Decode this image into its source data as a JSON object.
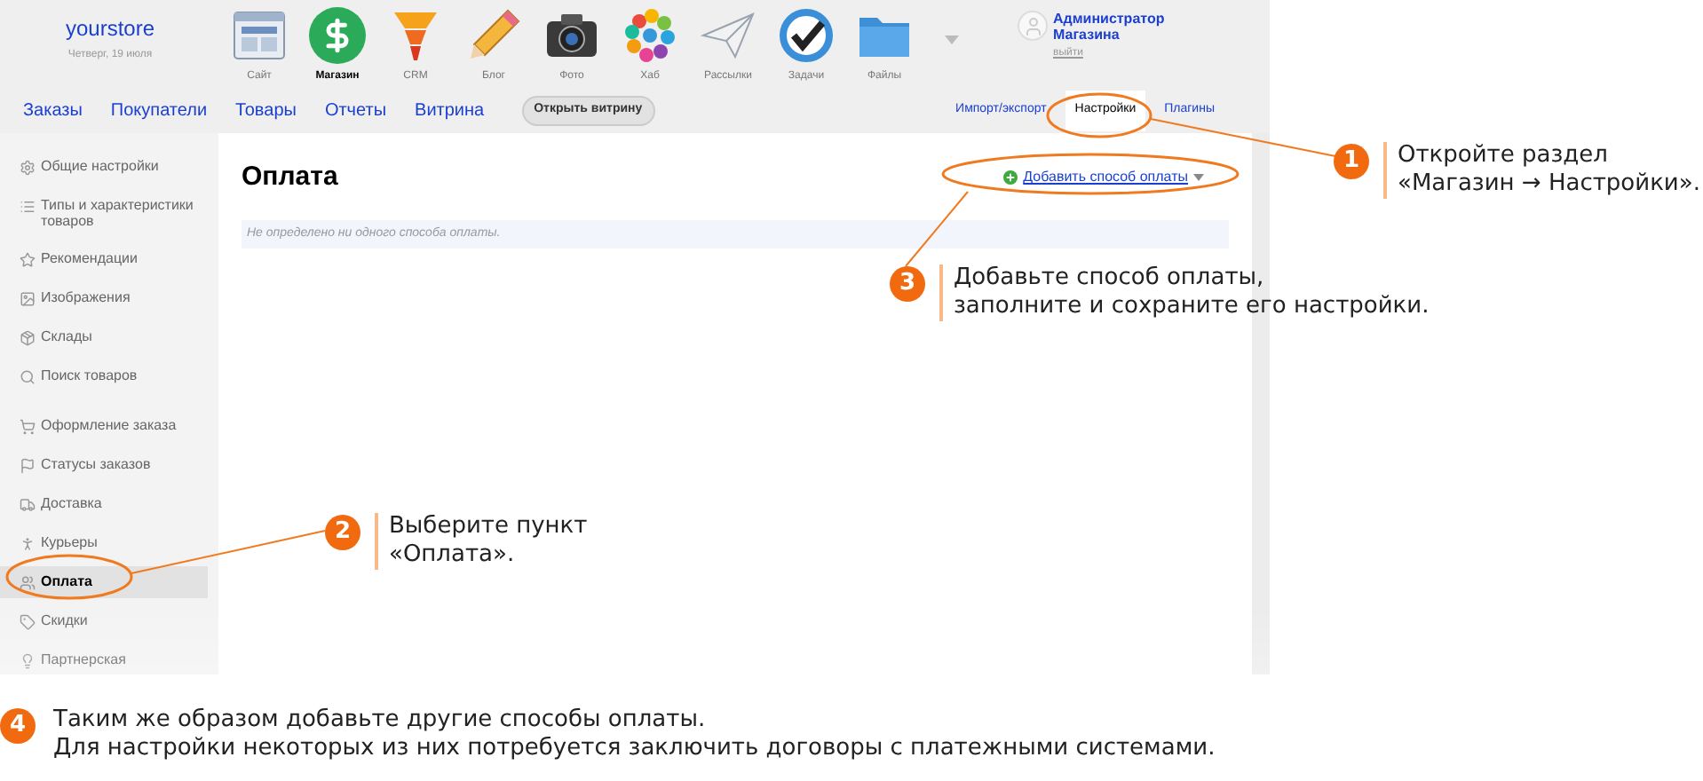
{
  "store": {
    "name": "yourstore",
    "date": "Четверг, 19 июля"
  },
  "apps": [
    {
      "label": "Сайт",
      "kind": "site",
      "selected": false
    },
    {
      "label": "Магазин",
      "kind": "shop",
      "selected": true
    },
    {
      "label": "CRM",
      "kind": "crm",
      "selected": false
    },
    {
      "label": "Блог",
      "kind": "blog",
      "selected": false
    },
    {
      "label": "Фото",
      "kind": "photo",
      "selected": false
    },
    {
      "label": "Хаб",
      "kind": "hub",
      "selected": false
    },
    {
      "label": "Рассылки",
      "kind": "mail",
      "selected": false
    },
    {
      "label": "Задачи",
      "kind": "tasks",
      "selected": false
    },
    {
      "label": "Файлы",
      "kind": "files",
      "selected": false
    }
  ],
  "user": {
    "name": "Администратор Магазина",
    "logout": "выйти"
  },
  "nav": {
    "items": [
      "Заказы",
      "Покупатели",
      "Товары",
      "Отчеты",
      "Витрина"
    ],
    "open_button": "Открыть витрину",
    "right": [
      {
        "label": "Импорт/экспорт",
        "selected": false
      },
      {
        "label": "Настройки",
        "selected": true
      },
      {
        "label": "Плагины",
        "selected": false
      }
    ]
  },
  "sidebar": {
    "groups": [
      [
        {
          "label": "Общие настройки",
          "selected": false
        },
        {
          "label": "Типы и характеристики товаров",
          "selected": false
        },
        {
          "label": "Рекомендации",
          "selected": false
        },
        {
          "label": "Изображения",
          "selected": false
        },
        {
          "label": "Склады",
          "selected": false
        },
        {
          "label": "Поиск товаров",
          "selected": false
        }
      ],
      [
        {
          "label": "Оформление заказа",
          "selected": false
        },
        {
          "label": "Статусы заказов",
          "selected": false
        },
        {
          "label": "Доставка",
          "selected": false
        },
        {
          "label": "Курьеры",
          "selected": false
        },
        {
          "label": "Оплата",
          "selected": true
        },
        {
          "label": "Скидки",
          "selected": false
        },
        {
          "label": "Партнерская",
          "selected": false
        }
      ]
    ]
  },
  "content": {
    "title": "Оплата",
    "add_link": "Добавить способ оплаты",
    "empty": "Не определено ни одного способа оплаты."
  },
  "steps": [
    {
      "number": "1",
      "lines": [
        "Откройте раздел",
        "«Магазин → Настройки»."
      ]
    },
    {
      "number": "2",
      "lines": [
        "Выберите пункт",
        "«Оплата»."
      ]
    },
    {
      "number": "3",
      "lines": [
        "Добавьте способ оплаты,",
        "заполните и сохраните его настройки."
      ]
    },
    {
      "number": "4",
      "lines": [
        "Таким же образом добавьте другие способы оплаты.",
        "Для настройки некоторых из них потребуется заключить договоры с платежными системами."
      ]
    }
  ]
}
